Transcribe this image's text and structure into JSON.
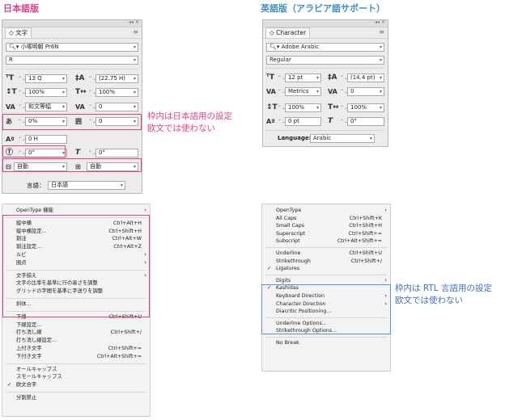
{
  "titles": {
    "japanese": "日本語版",
    "english": "英語版（アラビア語サポート）"
  },
  "jp_panel": {
    "tab": "文字",
    "font_family": "小塚明朝 Pr6N",
    "font_style": "R",
    "size": "13 Q",
    "leading": "(22.75 H)",
    "vscale": "100%",
    "hscale": "100%",
    "kerning": "和文等幅",
    "tracking": "0",
    "tsume": "0%",
    "aki": "0",
    "baseline": "0 H",
    "rotate": "0°",
    "skew": "0°",
    "aki_before": "自動",
    "aki_after": "自動",
    "language_label": "言語：",
    "language": "日本語",
    "note": [
      "枠内は日本語用の設定",
      "欧文では使わない"
    ]
  },
  "en_panel": {
    "tab": "Character",
    "font_family": "Adobe Arabic",
    "font_style": "Regular",
    "size": "12 pt",
    "leading": "(14.4 pt)",
    "kerning": "Metrics",
    "tracking": "0",
    "vscale": "100%",
    "hscale": "100%",
    "baseline": "0 pt",
    "skew": "0°",
    "language_label": "Language:",
    "language": "Arabic"
  },
  "jp_menu": [
    {
      "label": "OpenType 機能",
      "sub": true
    },
    {
      "sep": true
    },
    {
      "label": "縦中横",
      "sc": "Ctrl+Alt+H"
    },
    {
      "label": "縦中横設定...",
      "sc": "Ctrl+Shift+H"
    },
    {
      "label": "割注",
      "sc": "Ctrl+Alt+W"
    },
    {
      "label": "割注設定...",
      "sc": "Ctrl+Alt+Z"
    },
    {
      "label": "ルビ",
      "sub": true
    },
    {
      "label": "圏点",
      "sub": true
    },
    {
      "sep": true
    },
    {
      "label": "文字揃え",
      "sub": true
    },
    {
      "label": "文字の比率を基準に行の高さを調整"
    },
    {
      "label": "グリッドの字間を基準に字送りを調整"
    },
    {
      "sep": true
    },
    {
      "label": "斜体..."
    },
    {
      "sep": true
    },
    {
      "label": "下線",
      "sc": "Ctrl+Shift+U"
    },
    {
      "label": "下線設定..."
    },
    {
      "label": "打ち消し線",
      "sc": "Ctrl+Shift+/"
    },
    {
      "label": "打ち消し線設定..."
    },
    {
      "label": "上付き文字",
      "sc": "Ctrl+Shift+="
    },
    {
      "label": "下付き文字",
      "sc": "Ctrl+Alt+Shift+="
    },
    {
      "sep": true
    },
    {
      "label": "オールキャップス"
    },
    {
      "label": "スモールキャップス"
    },
    {
      "label": "欧文合字",
      "check": true
    },
    {
      "sep": true
    },
    {
      "label": "分割禁止"
    }
  ],
  "en_menu": [
    {
      "label": "OpenType",
      "sub": true
    },
    {
      "label": "All Caps",
      "sc": "Ctrl+Shift+K"
    },
    {
      "label": "Small Caps",
      "sc": "Ctrl+Shift+H"
    },
    {
      "label": "Superscript",
      "sc": "Ctrl+Shift+="
    },
    {
      "label": "Subscript",
      "sc": "Ctrl+Alt+Shift+="
    },
    {
      "sep": true
    },
    {
      "label": "Underline",
      "sc": "Ctrl+Shift+U"
    },
    {
      "label": "Strikethrough",
      "sc": "Ctrl+Shift+/"
    },
    {
      "label": "Ligatures",
      "check": true
    },
    {
      "sep": true
    },
    {
      "label": "Digits",
      "sub": true
    },
    {
      "label": "Kashidas",
      "check": true
    },
    {
      "label": "Keyboard Direction",
      "sub": true
    },
    {
      "label": "Character Direction",
      "sub": true
    },
    {
      "label": "Diacritic Positioning..."
    },
    {
      "sep": true
    },
    {
      "label": "Underline Options..."
    },
    {
      "label": "Strikethrough Options..."
    },
    {
      "sep": true
    },
    {
      "label": "No Break"
    }
  ],
  "en_note": [
    "枠内は RTL 言語用の設定",
    "欧文では使わない"
  ],
  "colors": {
    "pink": "#e0408a",
    "blue": "#5c8fd6",
    "panel_bg": "#ececec"
  }
}
